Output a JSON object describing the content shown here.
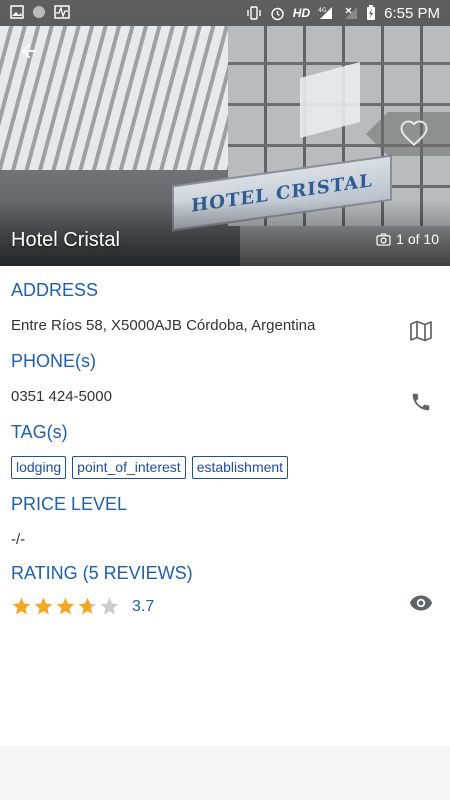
{
  "statusbar": {
    "hd": "HD",
    "network": "4G",
    "time": "6:55 PM"
  },
  "hero": {
    "title": "Hotel Cristal",
    "photo_count": "1 of 10",
    "sign_text": "HOTEL CRISTAL"
  },
  "sections": {
    "address": {
      "title": "ADDRESS",
      "value": "Entre Ríos 58, X5000AJB Córdoba, Argentina"
    },
    "phone": {
      "title": "PHONE(s)",
      "value": "0351 424-5000"
    },
    "tags": {
      "title": "TAG(s)",
      "items": [
        "lodging",
        "point_of_interest",
        "establishment"
      ]
    },
    "price": {
      "title": "PRICE LEVEL",
      "value": "-/-"
    },
    "rating": {
      "title": "RATING (5 REVIEWS)",
      "value": "3.7",
      "stars": 3.7,
      "max_stars": 5
    }
  },
  "colors": {
    "accent": "#1e5fb0",
    "star": "#f5a623",
    "star_empty": "#cccccc",
    "icon": "#5f6368"
  },
  "icons": [
    "back-arrow-icon",
    "heart-icon",
    "camera-icon",
    "map-icon",
    "phone-icon",
    "eye-icon"
  ]
}
